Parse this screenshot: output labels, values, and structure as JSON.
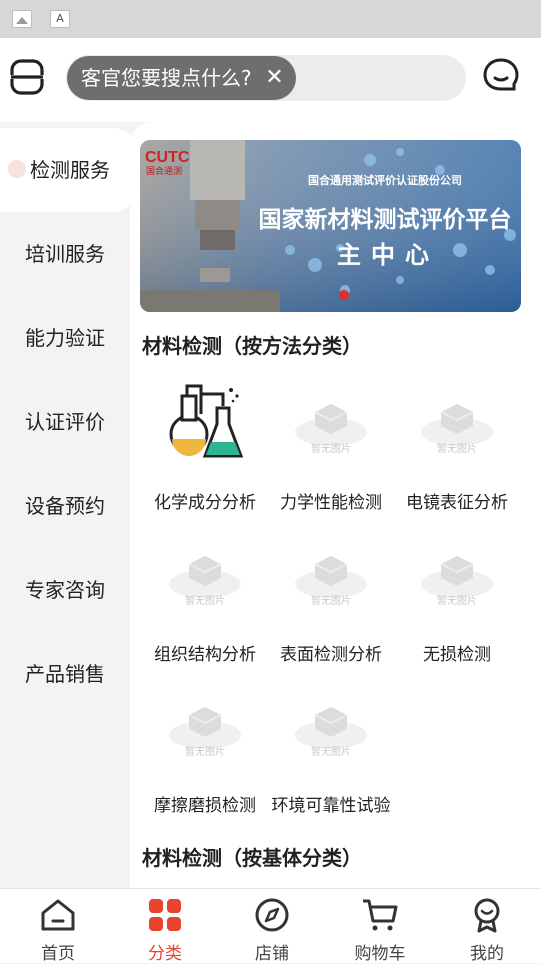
{
  "header": {
    "search_text": "客官您要搜点什么?",
    "clear_symbol": "✕"
  },
  "sidebar": {
    "items": [
      {
        "label": "检测服务"
      },
      {
        "label": "培训服务"
      },
      {
        "label": "能力验证"
      },
      {
        "label": "认证评价"
      },
      {
        "label": "设备预约"
      },
      {
        "label": "专家咨询"
      },
      {
        "label": "产品销售"
      }
    ]
  },
  "banner": {
    "logo_text": "CUTC",
    "logo_sub": "国合通测",
    "company": "国合通用测试评价认证股份公司",
    "title_line1": "国家新材料测试评价平台",
    "title_line2": "主中心"
  },
  "sections": [
    {
      "title": "材料检测（按方法分类）",
      "items": [
        {
          "label": "化学成分分析",
          "icon": "chemistry-flask-icon"
        },
        {
          "label": "力学性能检测",
          "icon": "placeholder-image-icon"
        },
        {
          "label": "电镜表征分析",
          "icon": "placeholder-image-icon"
        },
        {
          "label": "组织结构分析",
          "icon": "placeholder-image-icon"
        },
        {
          "label": "表面检测分析",
          "icon": "placeholder-image-icon"
        },
        {
          "label": "无损检测",
          "icon": "placeholder-image-icon"
        },
        {
          "label": "摩擦磨损检测",
          "icon": "placeholder-image-icon"
        },
        {
          "label": "环境可靠性试验",
          "icon": "placeholder-image-icon"
        }
      ]
    },
    {
      "title": "材料检测（按基体分类）",
      "items": []
    }
  ],
  "placeholder_text": "暂无图片",
  "tabbar": {
    "items": [
      {
        "label": "首页",
        "icon": "home-icon"
      },
      {
        "label": "分类",
        "icon": "category-grid-icon"
      },
      {
        "label": "店铺",
        "icon": "compass-icon"
      },
      {
        "label": "购物车",
        "icon": "cart-icon"
      },
      {
        "label": "我的",
        "icon": "profile-icon"
      }
    ],
    "active_color": "#e8432e"
  }
}
